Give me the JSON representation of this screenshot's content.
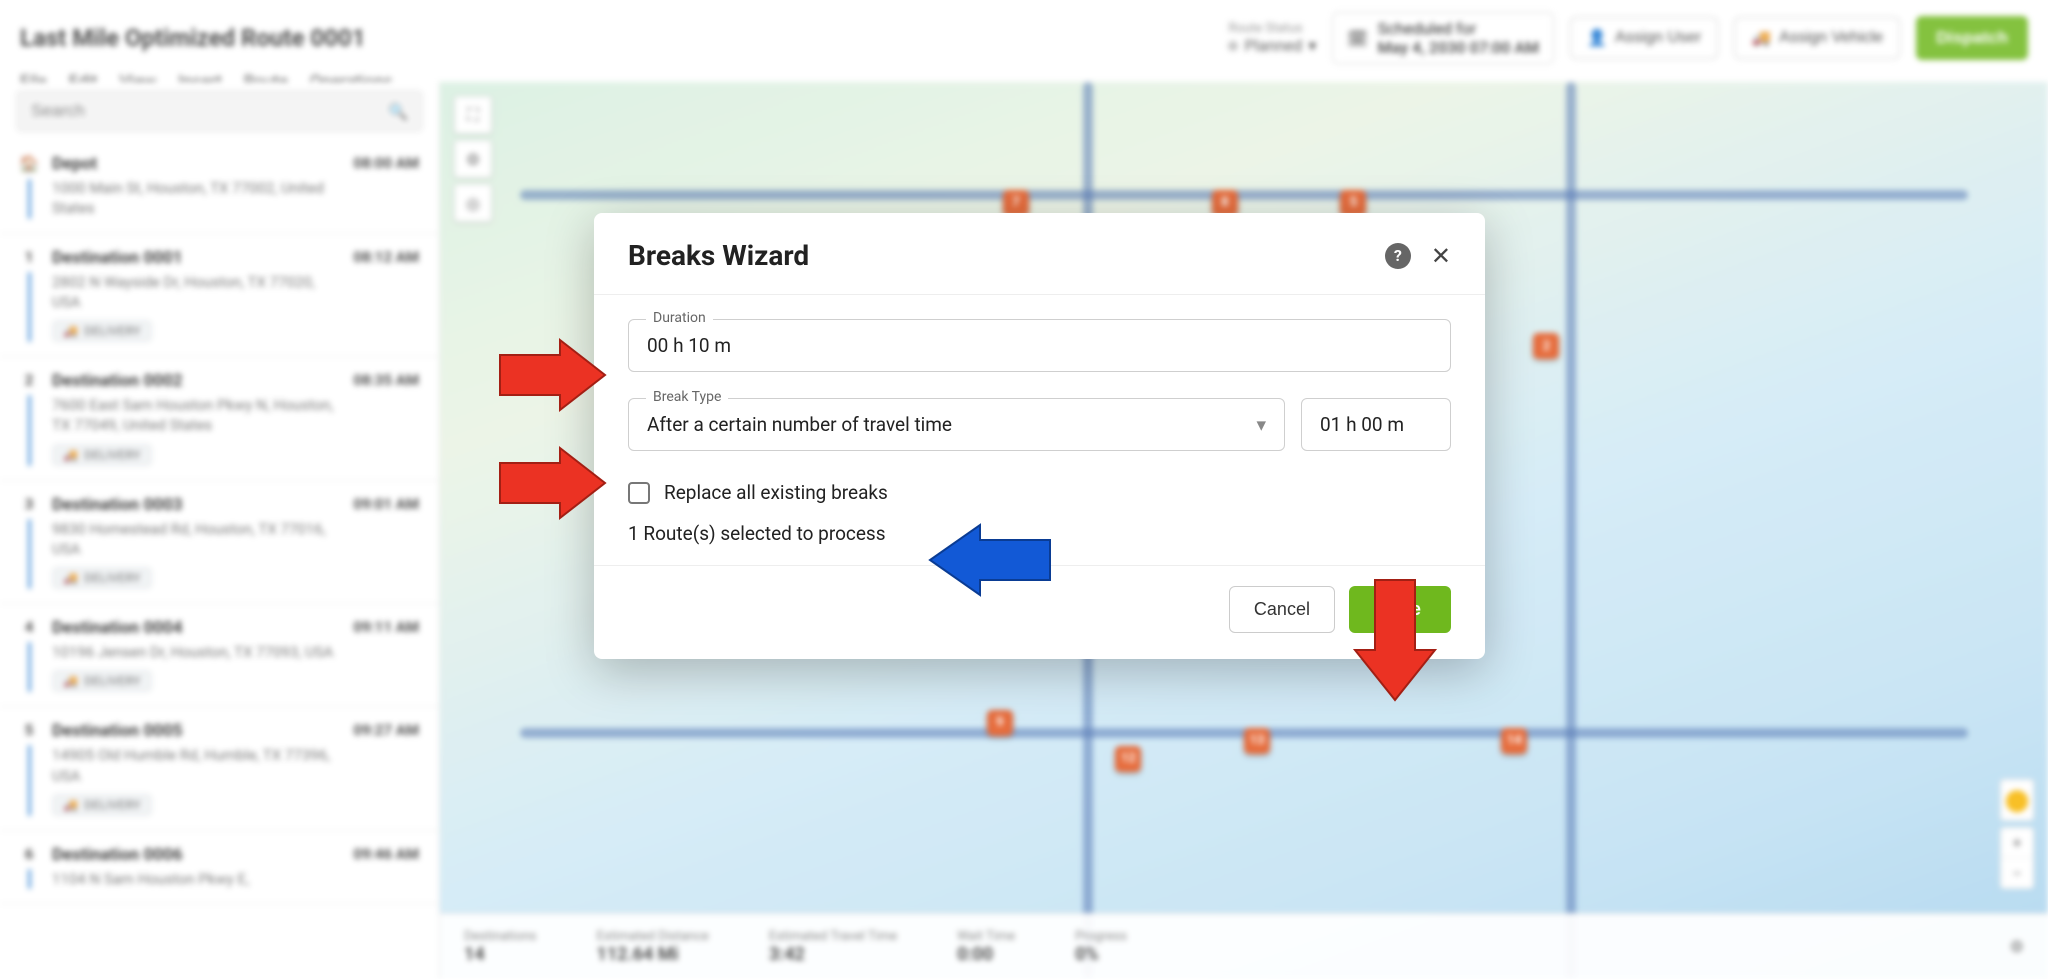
{
  "header": {
    "title": "Last Mile Optimized Route 0001",
    "menu": {
      "file": "File",
      "edit": "Edit",
      "view": "View",
      "insert": "Insert",
      "route": "Route",
      "operations": "Operations"
    },
    "status_label": "Route Status",
    "status_value": "Planned",
    "scheduled_label": "Scheduled for",
    "scheduled_value": "May 4, 2030 07:00 AM",
    "assign_user": "Assign User",
    "assign_vehicle": "Assign Vehicle",
    "dispatch": "Dispatch"
  },
  "search": {
    "placeholder": "Search"
  },
  "stops": [
    {
      "marker": "home",
      "name": "Depot",
      "addr": "1000 Main St, Houston, TX 77002, United States",
      "time": "08:00 AM",
      "tag": ""
    },
    {
      "marker": "1",
      "name": "Destination 0001",
      "addr": "2802 N Wayside Dr, Houston, TX 77020, USA",
      "time": "08:12 AM",
      "tag": "DELIVERY"
    },
    {
      "marker": "2",
      "name": "Destination 0002",
      "addr": "7600 East Sam Houston Pkwy N, Houston, TX 77049, United States",
      "time": "08:35 AM",
      "tag": "DELIVERY"
    },
    {
      "marker": "3",
      "name": "Destination 0003",
      "addr": "9830 Homestead Rd, Houston, TX 77016, USA",
      "time": "09:01 AM",
      "tag": "DELIVERY"
    },
    {
      "marker": "4",
      "name": "Destination 0004",
      "addr": "10196 Jensen Dr, Houston, TX 77093, USA",
      "time": "09:11 AM",
      "tag": "DELIVERY"
    },
    {
      "marker": "5",
      "name": "Destination 0005",
      "addr": "14905 Old Humble Rd, Humble, TX 77396, USA",
      "time": "09:27 AM",
      "tag": "DELIVERY"
    },
    {
      "marker": "6",
      "name": "Destination 0006",
      "addr": "1104 N Sam Houston Pkwy E,",
      "time": "09:46 AM",
      "tag": ""
    }
  ],
  "stats": {
    "destinations_label": "Destinations",
    "destinations_value": "14",
    "distance_label": "Estimated Distance",
    "distance_value": "112.64 Mi",
    "travel_label": "Estimated Travel Time",
    "travel_value": "3:42",
    "wait_label": "Wait Time",
    "wait_value": "0:00",
    "progress_label": "Progress",
    "progress_value": "0%"
  },
  "modal": {
    "title": "Breaks Wizard",
    "duration_label": "Duration",
    "duration_value": "00 h  10 m",
    "break_type_label": "Break Type",
    "break_type_value": "After a certain number of travel time",
    "break_type_time": "01 h  00 m",
    "replace_label": "Replace all existing breaks",
    "routes_selected": "1 Route(s) selected to process",
    "cancel": "Cancel",
    "save": "Save"
  },
  "map_markers": [
    "7",
    "8",
    "5",
    "2",
    "9",
    "12",
    "13",
    "14"
  ]
}
